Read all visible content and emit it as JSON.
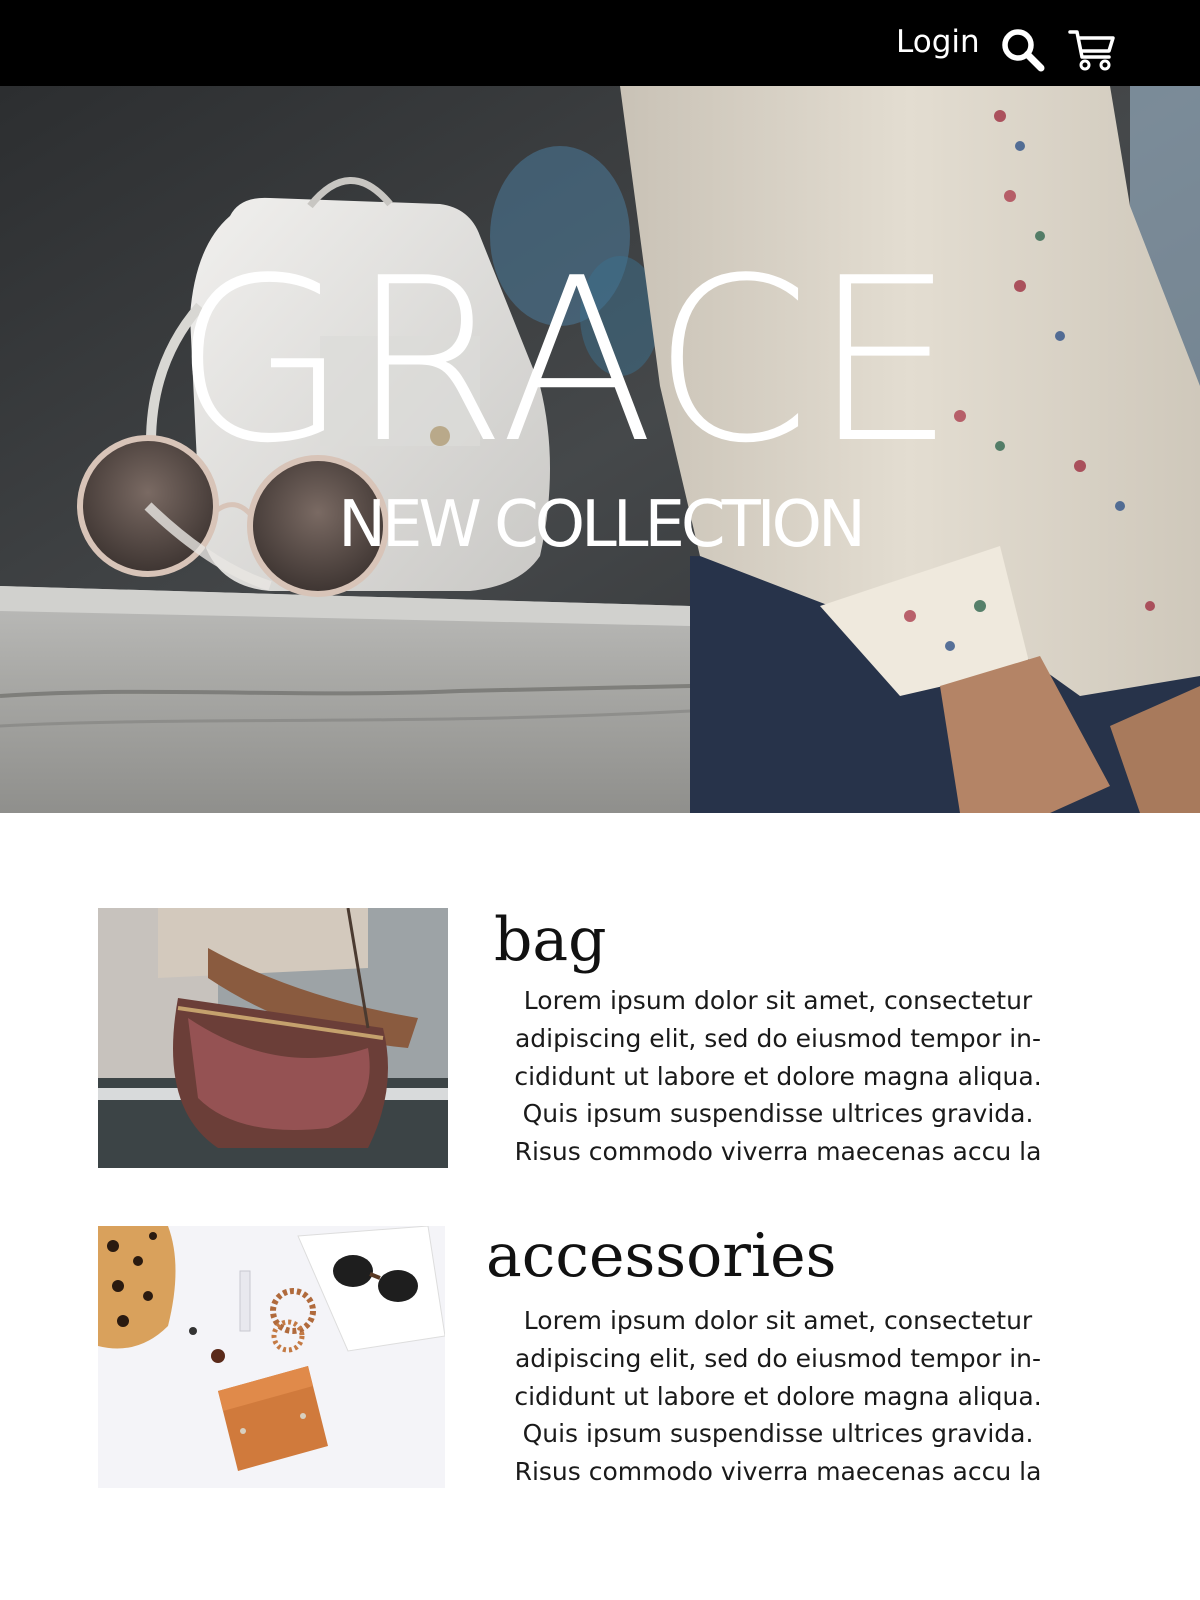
{
  "header": {
    "login_label": "Login",
    "search_icon": "search-icon",
    "cart_icon": "cart-icon",
    "background": "#000000",
    "text_color": "#ffffff"
  },
  "hero": {
    "title": "GRACE",
    "subtitle": "NEW COLLECTION",
    "photo": "white-handbag-sunglasses-embroidered-blouse"
  },
  "products": [
    {
      "title": "bag",
      "image": "model-holding-camouflage-leather-bag",
      "description_lines": [
        "Lorem ipsum dolor sit amet, consectetur",
        "adipiscing elit, sed do eiusmod tempor in-",
        "cididunt ut labore et dolore magna aliqua.",
        "Quis ipsum suspendisse ultrices gravida.",
        "Risus commodo viverra maecenas accu la"
      ]
    },
    {
      "title": "accessories",
      "image": "flatlay-sunglasses-wallet-bracelets-leopard-shoes",
      "description_lines": [
        "Lorem ipsum dolor sit amet, consectetur",
        "adipiscing elit, sed do eiusmod tempor in-",
        "cididunt ut labore et dolore magna aliqua.",
        "Quis ipsum suspendisse ultrices gravida.",
        "Risus commodo viverra maecenas accu la"
      ]
    }
  ]
}
